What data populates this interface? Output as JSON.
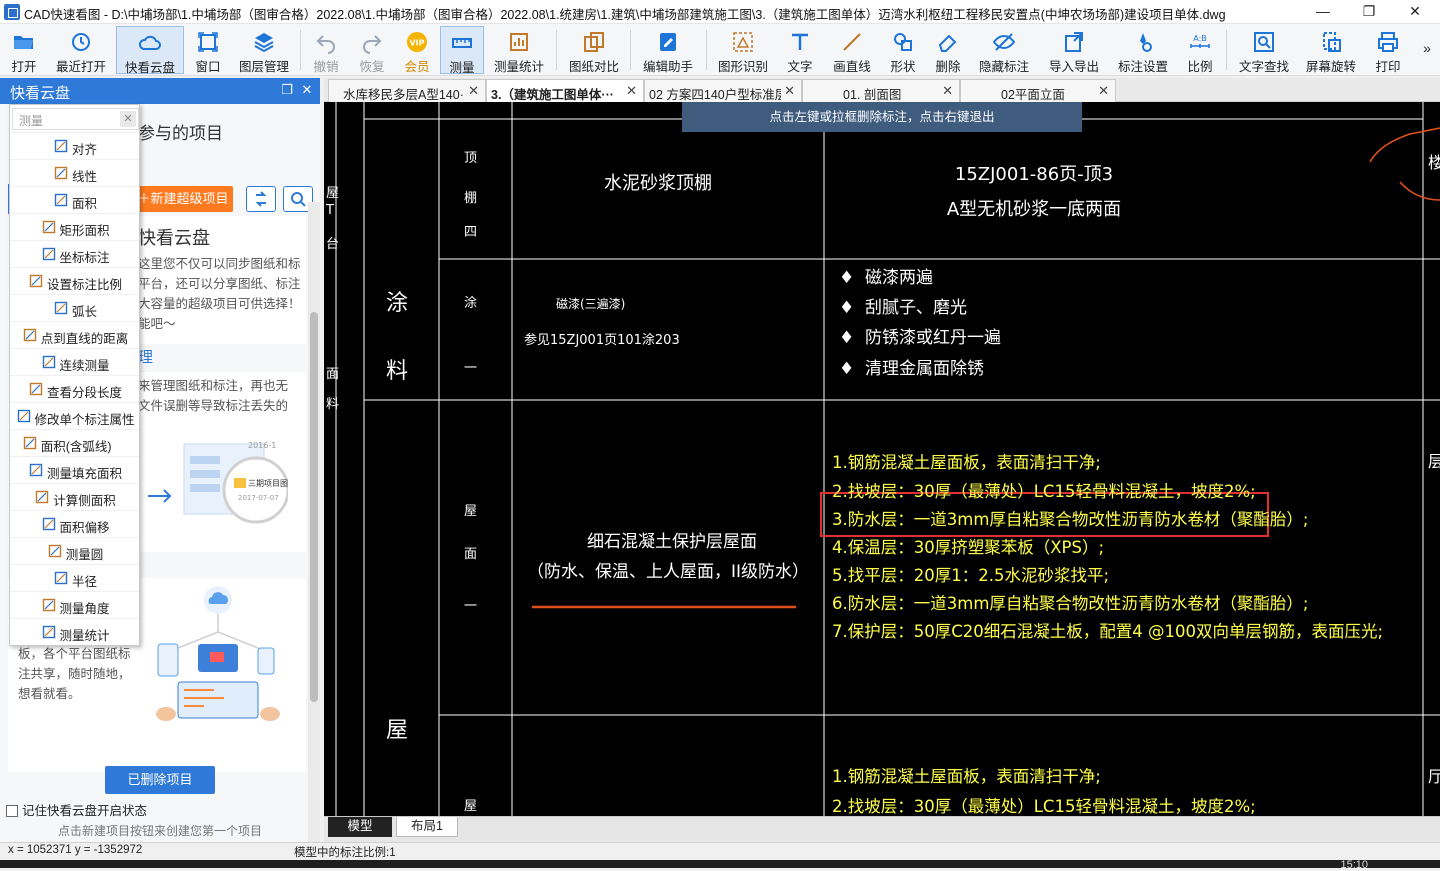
{
  "window": {
    "title": "CAD快速看图 - D:\\中埔场部\\1.中埔场部（图审合格）2022.08\\1.中埔场部（图审合格）2022.08\\1.统建房\\1.建筑\\中埔场部建筑施工图\\3.（建筑施工图单体）迈湾水利枢纽工程移民安置点(中坤农场场部)建设项目单体.dwg",
    "minimize": "—",
    "maximize": "❐",
    "close": "✕"
  },
  "toolbar": {
    "items": [
      {
        "label": "打开",
        "icon": "folder-icon"
      },
      {
        "label": "最近打开",
        "icon": "history-icon"
      },
      {
        "label": "快看云盘",
        "icon": "cloud-icon"
      },
      {
        "label": "窗口",
        "icon": "window-icon"
      },
      {
        "label": "图层管理",
        "icon": "layers-icon"
      },
      {
        "label": "撤销",
        "icon": "undo-icon"
      },
      {
        "label": "恢复",
        "icon": "redo-icon"
      },
      {
        "label": "会员",
        "icon": "vip-icon"
      },
      {
        "label": "测量",
        "icon": "ruler-icon"
      },
      {
        "label": "测量统计",
        "icon": "measure-stats-icon"
      },
      {
        "label": "图纸对比",
        "icon": "compare-icon"
      },
      {
        "label": "编辑助手",
        "icon": "edit-assistant-icon"
      },
      {
        "label": "图形识别",
        "icon": "shape-recognize-icon"
      },
      {
        "label": "文字",
        "icon": "text-icon"
      },
      {
        "label": "画直线",
        "icon": "line-icon"
      },
      {
        "label": "形状",
        "icon": "shape-icon"
      },
      {
        "label": "删除",
        "icon": "eraser-icon"
      },
      {
        "label": "隐藏标注",
        "icon": "hide-annotation-icon"
      },
      {
        "label": "导入导出",
        "icon": "import-export-icon"
      },
      {
        "label": "标注设置",
        "icon": "annotation-settings-icon"
      },
      {
        "label": "比例",
        "icon": "scale-icon"
      },
      {
        "label": "文字查找",
        "icon": "text-search-icon"
      },
      {
        "label": "屏幕旋转",
        "icon": "rotate-screen-icon"
      },
      {
        "label": "打印",
        "icon": "print-icon"
      }
    ],
    "more": "»",
    "vip_text": "VIP"
  },
  "side_panel": {
    "title": "快看云盘",
    "heading_partial": "参与的项目",
    "new_super_project": "新建超级项目",
    "promo_title": "快看云盘",
    "promo_lines_1": [
      "这里您不仅可以同步图纸和标",
      "平台，还可以分享图纸、标注",
      "大容量的超级项目可供选择！",
      "能吧～"
    ],
    "promo_sub": "理",
    "promo_lines_2": [
      "来管理图纸和标注，再也无",
      "文件误删等导致标注丢失的"
    ],
    "illus_date1": "2016-1",
    "illus_label": "三期项目图",
    "illus_date2": "2017-07-07",
    "promo_lines_3": [
      "板，各个平台图纸标",
      "注共享，随时随地，",
      "想看就看。"
    ],
    "deleted_projects": "已删除项目",
    "remember_label": "记住快看云盘开启状态",
    "hint": "点击新建项目按钮来创建您第一个项目",
    "side_letters": [
      "屋",
      "T",
      "台",
      "面",
      "料"
    ]
  },
  "measure_menu": {
    "search_placeholder": "测量",
    "items": [
      {
        "label": "对齐",
        "icon": "align-measure-icon"
      },
      {
        "label": "线性",
        "icon": "linear-measure-icon"
      },
      {
        "label": "面积",
        "icon": "area-icon"
      },
      {
        "label": "矩形面积",
        "icon": "rect-area-icon"
      },
      {
        "label": "坐标标注",
        "icon": "coordinate-icon"
      },
      {
        "label": "设置标注比例",
        "icon": "set-scale-icon"
      },
      {
        "label": "弧长",
        "icon": "arc-length-icon"
      },
      {
        "label": "点到直线的距离",
        "icon": "point-line-distance-icon"
      },
      {
        "label": "连续测量",
        "icon": "continuous-measure-icon"
      },
      {
        "label": "查看分段长度",
        "icon": "segment-length-icon"
      },
      {
        "label": "修改单个标注属性",
        "icon": "edit-annotation-icon"
      },
      {
        "label": "面积(含弧线)",
        "icon": "area-arc-icon"
      },
      {
        "label": "测量填充面积",
        "icon": "fill-area-icon"
      },
      {
        "label": "计算侧面积",
        "icon": "side-area-icon"
      },
      {
        "label": "面积偏移",
        "icon": "area-offset-icon"
      },
      {
        "label": "测量圆",
        "icon": "measure-circle-icon"
      },
      {
        "label": "半径",
        "icon": "radius-icon"
      },
      {
        "label": "测量角度",
        "icon": "angle-icon"
      },
      {
        "label": "测量统计",
        "icon": "measure-stats-icon"
      }
    ]
  },
  "doc_tabs": [
    {
      "label": "水库移民多层A型140···",
      "active": false
    },
    {
      "label": "3.（建筑施工图单体···",
      "active": true
    },
    {
      "label": "02 方案四140户型标准层",
      "active": false
    },
    {
      "label": "01. 剖面图",
      "active": false
    },
    {
      "label": "02平面立面",
      "active": false
    }
  ],
  "canvas": {
    "notice": "点击左键或拉框删除标注，点击右键退出",
    "row1": {
      "cat": [
        "顶",
        "棚",
        "四"
      ],
      "name": "水泥砂浆顶棚",
      "spec_line1": "15ZJ001-86页-顶3",
      "spec_line2": "A型无机砂浆一底两面"
    },
    "row2": {
      "left": [
        "涂",
        "料"
      ],
      "cat": [
        "涂",
        "一"
      ],
      "name": "磁漆(三遍漆)",
      "ref": "参见15ZJ001页101涂203",
      "bullets": [
        "磁漆两遍",
        "刮腻子、磨光",
        "防锈漆或红丹一遍",
        "清理金属面除锈"
      ]
    },
    "row3": {
      "left": "屋",
      "cat": [
        "屋",
        "面",
        "一"
      ],
      "name_line1": "细石混凝土保护层屋面",
      "name_line2": "（防水、保温、上人屋面，II级防水）",
      "items": [
        "1.钢筋混凝土屋面板，表面清扫干净;",
        "2.找坡层：30厚（最薄处）LC15轻骨料混凝土，坡度2%;",
        "3.防水层：一道3mm厚自粘聚合物改性沥青防水卷材（聚酯胎）;",
        "4.保温层：30厚挤塑聚苯板（XPS）;",
        "5.找平层：20厚1：2.5水泥砂浆找平;",
        "6.防水层：一道3mm厚自粘聚合物改性沥青防水卷材（聚酯胎）;",
        "7.保护层：50厚C20细石混凝土板，配置4 @100双向单层钢筋，表面压光;"
      ]
    },
    "row4": {
      "cat": "屋",
      "items": [
        "1.钢筋混凝土屋面板，表面清扫干净;",
        "2.找坡层：30厚（最薄处）LC15轻骨料混凝土，坡度2%;"
      ]
    },
    "right_edge": [
      "楼",
      "层",
      "厅"
    ]
  },
  "layout_tabs": [
    {
      "label": "模型",
      "active": true
    },
    {
      "label": "布局1",
      "active": false
    }
  ],
  "status": {
    "coords": "x = 1052371  y = -1352972",
    "scale": "模型中的标注比例:1",
    "clock": "15:10"
  },
  "colors": {
    "accent": "#2f7ad8",
    "orange": "#ff7a1f",
    "cad_yellow": "#ffff4a",
    "cad_white": "#ffffff",
    "highlight_red": "#e03030",
    "markup_orange": "#e0501a"
  }
}
